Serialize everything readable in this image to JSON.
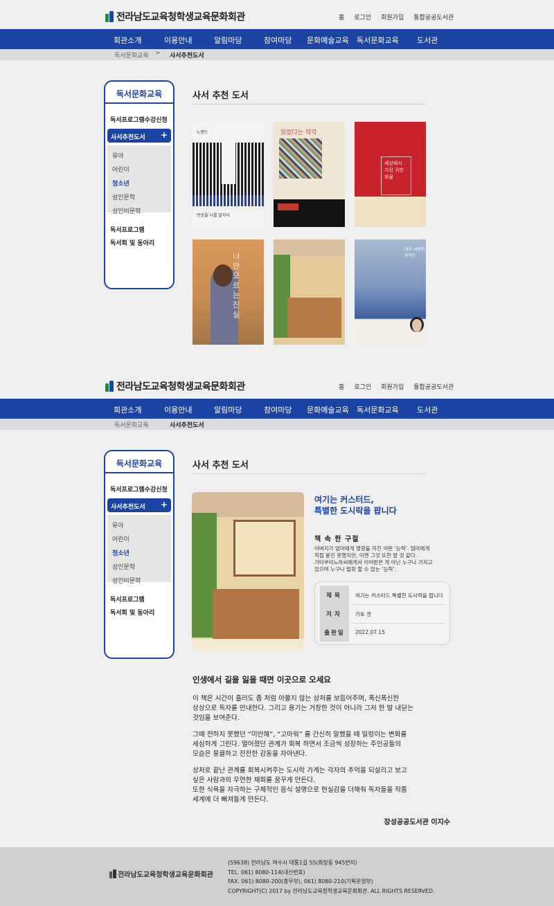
{
  "site": {
    "title": "전라남도교육청학생교육문화회관",
    "util_links": [
      "홈",
      "로그인",
      "회원가입",
      "통합공공도서관"
    ],
    "nav": [
      "회관소개",
      "이용안내",
      "알림마당",
      "참여마당",
      "문화예술교육",
      "독서문화교육",
      "도서관"
    ],
    "breadcrumb": {
      "parent": "독서문화교육",
      "separator": ">",
      "current": "사서추천도서"
    }
  },
  "sidebar": {
    "title": "독서문화교육",
    "item_program_apply": "독서프로그램수강신청",
    "active": {
      "label": "사서추천도서",
      "toggle": "+"
    },
    "sub_items": [
      "유아",
      "어린이",
      "청소년",
      "성인문학",
      "성인비문학"
    ],
    "selected_sub": "청소년",
    "item_program": "독서프로그램",
    "item_club": "독서회 및 동아리"
  },
  "page_title": "사서 추천 도서",
  "covers": [
    {
      "title": "노랜드",
      "snippet": "빈곳을 나를 말하다"
    },
    {
      "title": "읽었다는 착각"
    },
    {
      "title": "세상에서 가장 귀한 화물"
    },
    {
      "title": "너만 모르는 진실"
    },
    {
      "title": "여기는 커스터드 특별한 도시락을 팝니다"
    },
    {
      "title": "내가 사랑한 파가는"
    }
  ],
  "detail": {
    "title_line1": "여기는 커스터드,",
    "title_line2": "특별한 도시락을 팝니다",
    "quote_heading": "책 속 한 구절",
    "quote_lines": [
      "아버지가 엄마에게 영향을 끼친 어떤 ‘능력’. 엄마에게",
      "직접 묻진 못했지만, 이젠 그것 또한 알 것 같다.",
      "가타쿠리노하씨에게서 이어받은 게 아닌 누구나 가지고",
      "있으며 누구나 발휘 할 수 있는 ‘능력’."
    ],
    "info": [
      {
        "key": "제목",
        "value": "여기는 커스터드 특별한 도시락을 팝니다"
      },
      {
        "key": "저자",
        "value": "가토 겐"
      },
      {
        "key": "출판일",
        "value": "2022.07.15"
      }
    ],
    "review_heading": "인생에서 길을 잃을 때면 이곳으로 오세요",
    "paragraphs": [
      [
        "이 책은 시간이 흘러도 좀 처럼 아물지 않는 상처를 보듬어주며, 폭신폭신한",
        "상상으로 독자를 안내한다. 그리고 용기는 거창한 것이 아니라 그저 한 발 내딛는",
        "것임을 보여준다."
      ],
      [
        "그때 전하지 못했던 “미안해”, “고마워” 를 간신히 말했을 때 일렁이는 변화를",
        "세심하게 그린다. 멀어졌던 관계가 회복 하면서 조금씩 성장하는 주인공들의",
        "모습은 뭉클하고 잔잔한 감동을 자아낸다."
      ],
      [
        "상처로 끝난 관계를 회복시켜주는 도시락 가게는 각자의 추억을 되살리고 보고",
        "싶은 사람과의 우연한 재회를 꿈꾸게 만든다.",
        "또한 식욕을 자극하는 구체적인 음식 설명으로 현실감을 더해줘 독자들을 작품",
        "세계에 더 빠져들게 만든다."
      ]
    ],
    "signature": "장성공공도서관 이지수"
  },
  "footer": {
    "logo": "전라남도교육청학생교육문화회관",
    "lines": [
      "(59638) 전라남도 여수시 대통1길 55(화장동 945번지)",
      "TEL. 061) 8080-114(내선번호)",
      "FAX. 061) 8080-200(총무부), 061) 8080-210(기획운영부)",
      "COPYRIGHT(C) 2017 by 전라남도교육청학생교육문화회관. ALL RIGHTS RESERVED."
    ]
  },
  "colors": {
    "brand_blue": "#1a43a4",
    "background": "#efefef",
    "footer": "#cfcfcf"
  }
}
